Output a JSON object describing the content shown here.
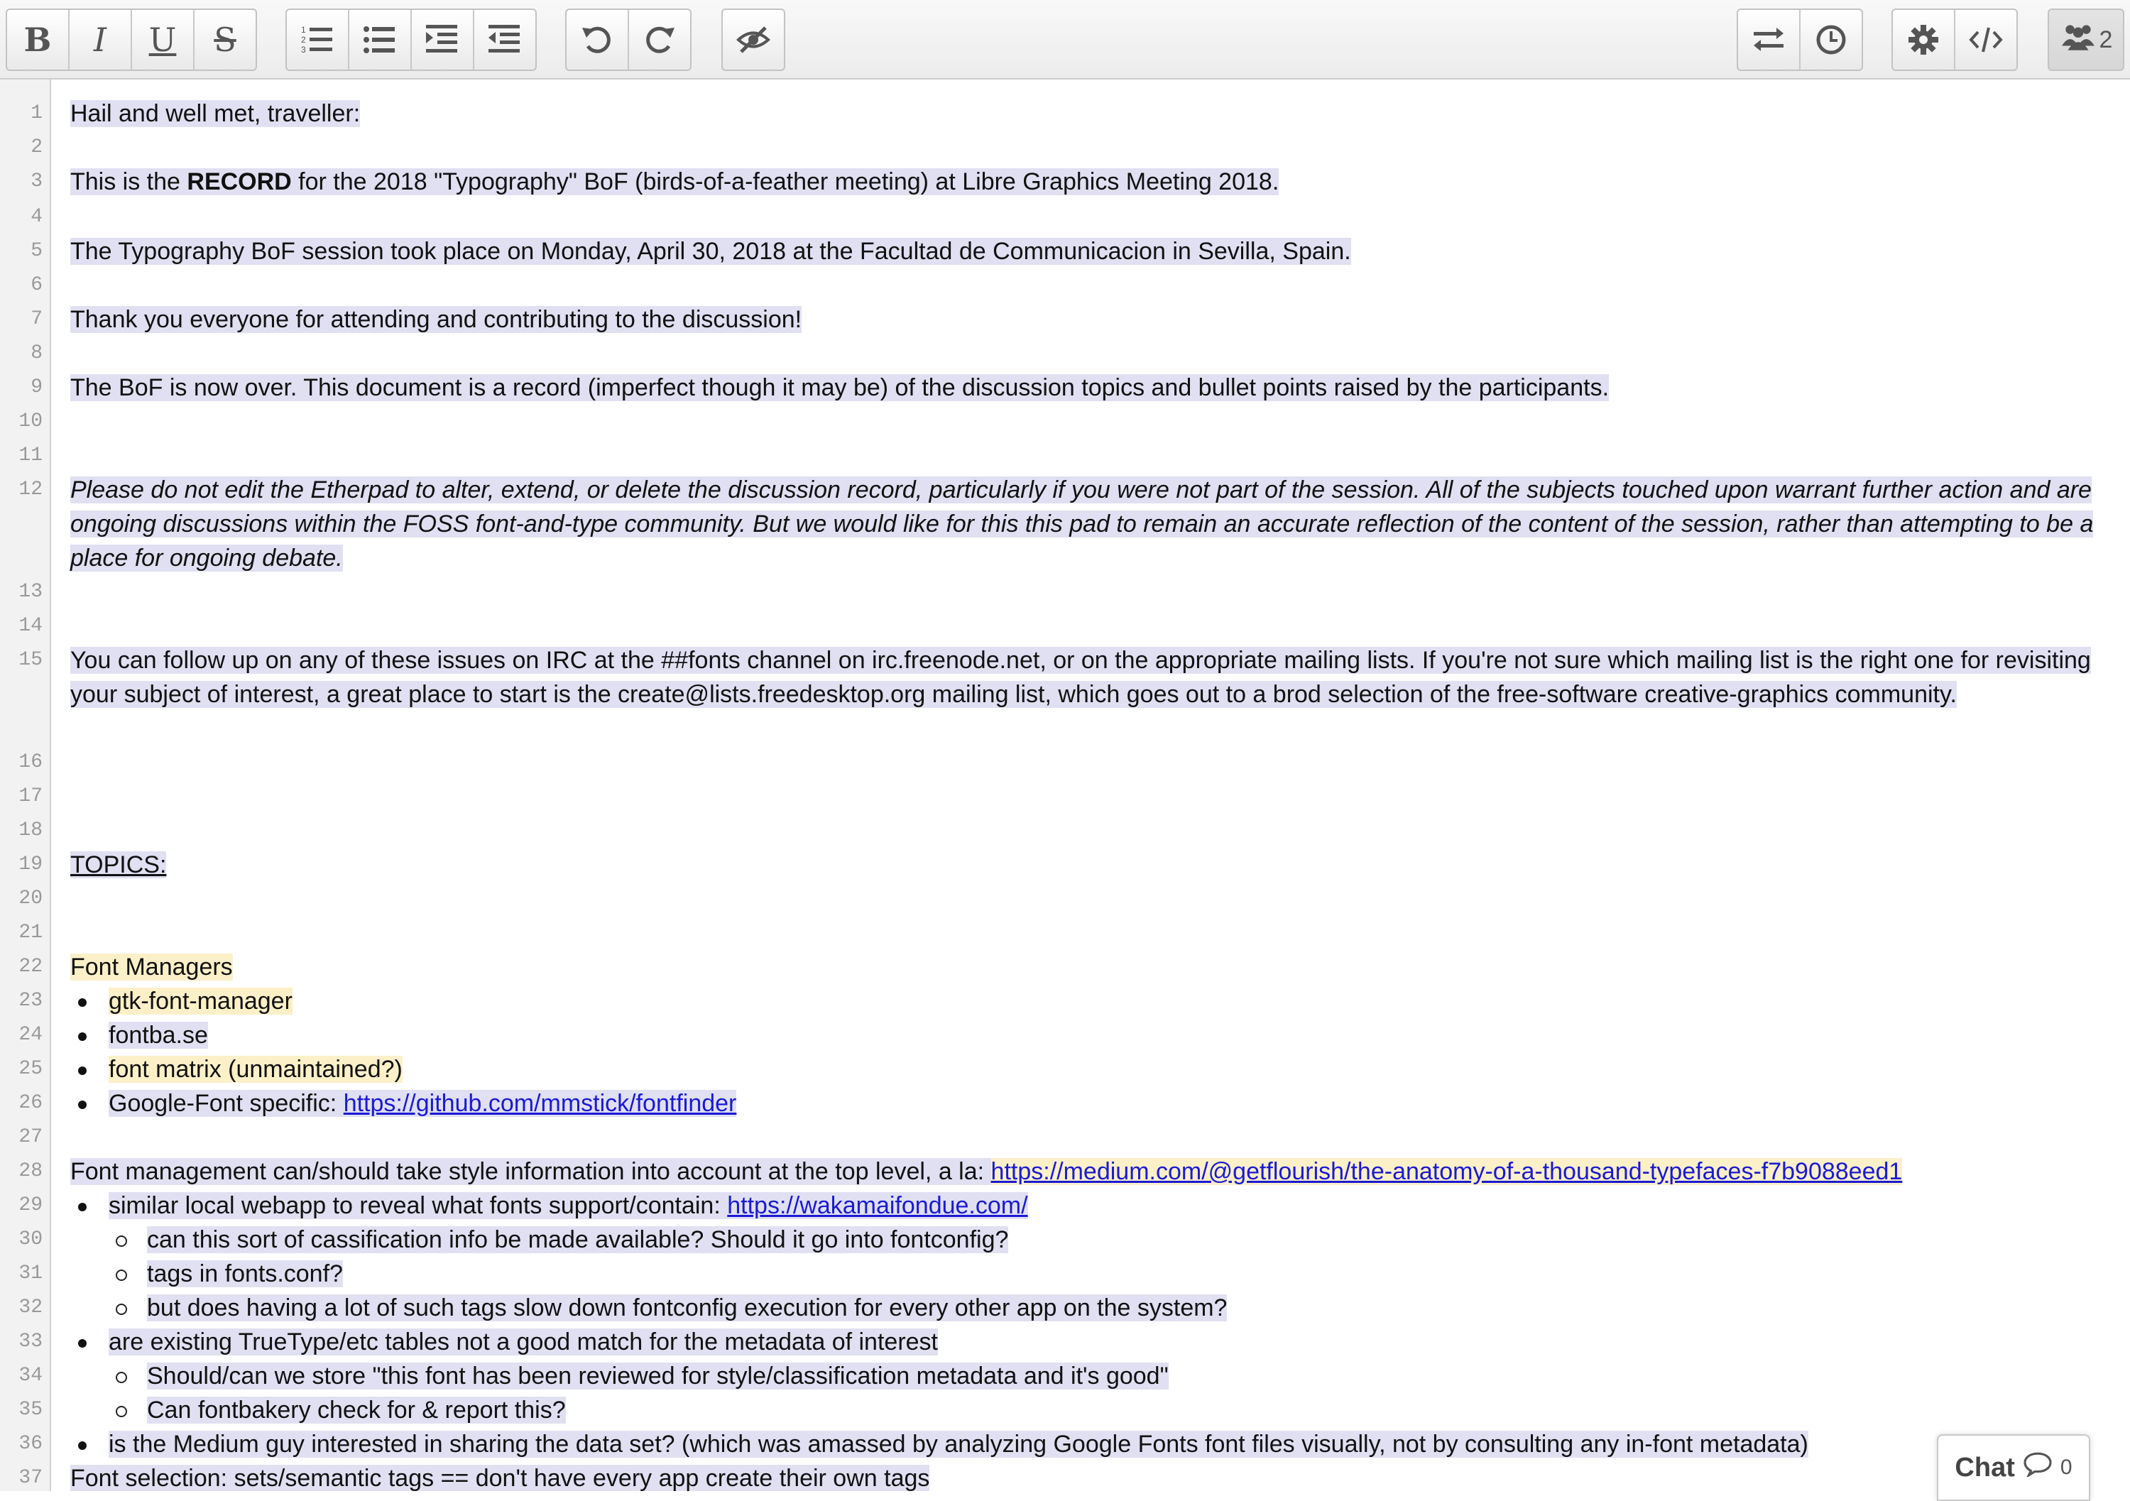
{
  "toolbar": {
    "formatting": [
      "bold-icon",
      "italic-icon",
      "underline-icon",
      "strikethrough-icon"
    ],
    "lists": [
      "ordered-list-icon",
      "unordered-list-icon",
      "indent-icon",
      "outdent-icon"
    ],
    "history": [
      "undo-icon",
      "redo-icon"
    ],
    "authorship": [
      "clear-authorship-icon"
    ],
    "right_tools": [
      "import-export-icon",
      "timeslider-icon"
    ],
    "settings_tools": [
      "settings-icon",
      "embed-icon"
    ],
    "users_count": "2"
  },
  "editor": {
    "lines": [
      {
        "n": "1",
        "text": "Hail and well met, traveller: "
      },
      {
        "n": "2",
        "text": ""
      },
      {
        "n": "3",
        "pre": "This is the ",
        "bold": "RECORD",
        "post": " for the 2018 \"Typography\" BoF (birds-of-a-feather meeting) at Libre Graphics Meeting 2018."
      },
      {
        "n": "4",
        "text": ""
      },
      {
        "n": "5",
        "text": "The Typography BoF session took place on Monday, April 30, 2018 at the Facultad de Communicacion in Sevilla, Spain."
      },
      {
        "n": "6",
        "text": ""
      },
      {
        "n": "7",
        "text": "Thank you everyone for attending and contributing to the discussion!"
      },
      {
        "n": "8",
        "text": ""
      },
      {
        "n": "9",
        "text": "The BoF is now over. This document is a record (imperfect though it may be) of the discussion topics and bullet points raised by the participants. "
      },
      {
        "n": "10",
        "text": ""
      },
      {
        "n": "11",
        "text": ""
      },
      {
        "n": "12",
        "text": "Please do not edit the Etherpad to alter, extend, or delete the discussion record, particularly if you were not part of the session. All of the subjects touched upon warrant further action and are ongoing discussions within the FOSS font-and-type community. But we would like for this this pad to remain an accurate reflection of the content of the session, rather than attempting to be a place for ongoing debate."
      },
      {
        "n": "13",
        "text": ""
      },
      {
        "n": "14",
        "text": ""
      },
      {
        "n": "15",
        "text": "You can follow up on any of these issues on IRC at the ##fonts channel on irc.freenode.net, or on the appropriate mailing lists. If you're not sure which mailing list is the right one for revisiting your subject of interest, a great place to start is the create@lists.freedesktop.org mailing list, which goes out to a brod selection of the free-software creative-graphics community."
      },
      {
        "n": "16",
        "text": ""
      },
      {
        "n": "17",
        "text": ""
      },
      {
        "n": "18",
        "text": "TOPICS:"
      },
      {
        "n": "19",
        "text": ""
      },
      {
        "n": "20",
        "text": ""
      },
      {
        "n": "21",
        "text": "Font Managers"
      },
      {
        "n": "22",
        "text": "gtk-font-manager"
      },
      {
        "n": "23",
        "text": "fontba.se"
      },
      {
        "n": "24",
        "text": "font matrix (unmaintained?) "
      },
      {
        "n": "25",
        "pre": "Google-Font specific: ",
        "link": "https://github.com/mmstick/fontfinder"
      },
      {
        "n": "26",
        "text": ""
      },
      {
        "n": "27",
        "pre": "Font management can/should take style information into account at the top level, a la: ",
        "link": "https://medium.com/@getflourish/the-anatomy-of-a-thousand-typefaces-f7b9088eed1"
      },
      {
        "n": "28",
        "pre": "similar local webapp to reveal what fonts support/contain: ",
        "link": "https://wakamaifondue.com/"
      },
      {
        "n": "29",
        "text": "can this sort of cassification info be made available? Should it go into fontconfig?"
      },
      {
        "n": "30",
        "text": "tags in fonts.conf?"
      },
      {
        "n": "31",
        "text": "but does having a lot of such tags slow down fontconfig execution for every other app on the system?"
      },
      {
        "n": "32",
        "text": "are existing TrueType/etc tables not a good match for the metadata of interest"
      },
      {
        "n": "33",
        "text": "Should/can we store \"this font has been reviewed for style/classification metadata and it's good\""
      },
      {
        "n": "34",
        "text": "Can fontbakery check for & report this?"
      },
      {
        "n": "35",
        "text": "is the Medium guy interested in sharing the data set? (which was amassed by analyzing Google Fonts font files visually, not by consulting any in-font metadata)"
      },
      {
        "n": "36",
        "text": ""
      },
      {
        "n": "37",
        "text": "Font selection: sets/semantic tags == don't have every app create their own tags"
      }
    ]
  },
  "chat": {
    "label": "Chat",
    "count": "0"
  }
}
